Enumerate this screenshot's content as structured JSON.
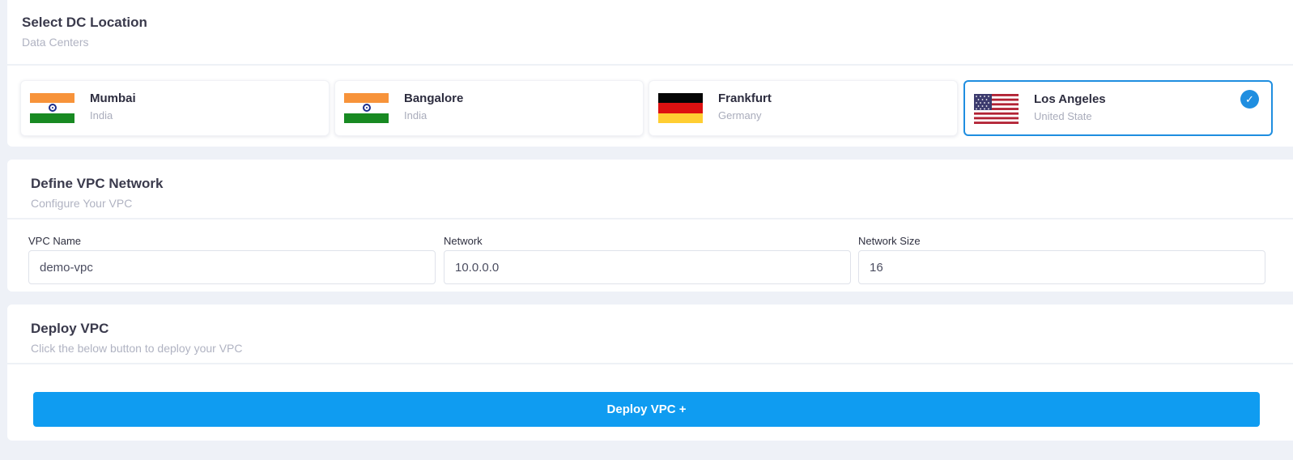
{
  "dc_section": {
    "title": "Select DC Location",
    "subtitle": "Data Centers",
    "locations": [
      {
        "city": "Mumbai",
        "country": "India",
        "flag": "india-flag",
        "selected": false
      },
      {
        "city": "Bangalore",
        "country": "India",
        "flag": "india-flag",
        "selected": false
      },
      {
        "city": "Frankfurt",
        "country": "Germany",
        "flag": "germany-flag",
        "selected": false
      },
      {
        "city": "Los Angeles",
        "country": "United State",
        "flag": "usa-flag",
        "selected": true
      }
    ],
    "selected_icon": "✓"
  },
  "vpc_section": {
    "title": "Define VPC Network",
    "subtitle": "Configure Your VPC",
    "fields": [
      {
        "label": "VPC Name",
        "value": "demo-vpc"
      },
      {
        "label": "Network",
        "value": "10.0.0.0"
      },
      {
        "label": "Network Size",
        "value": "16"
      }
    ]
  },
  "deploy_section": {
    "title": "Deploy VPC",
    "subtitle": "Click the below button to deploy your VPC",
    "button_label": "Deploy VPC +"
  },
  "colors": {
    "accent": "#1f8ee0",
    "button": "#0f9cf1",
    "background": "#eef1f7"
  }
}
